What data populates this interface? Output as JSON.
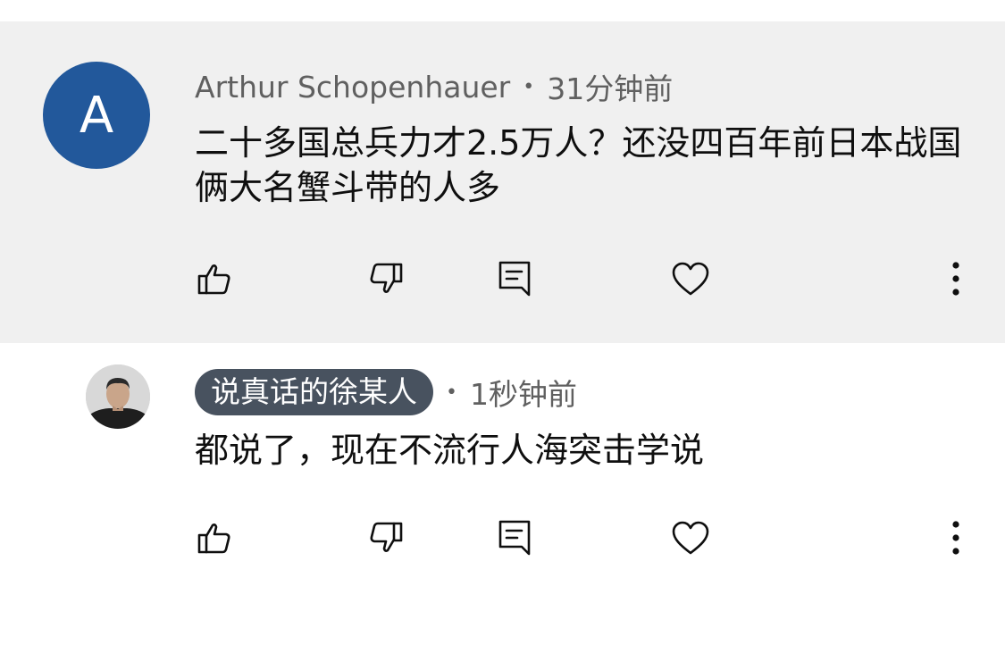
{
  "comments": [
    {
      "avatar": {
        "letter": "A",
        "color": "#22589b"
      },
      "author": "Arthur Schopenhauer",
      "separator": "•",
      "time": "31分钟前",
      "text": "二十多国总兵力才2.5万人？还没四百年前日本战国俩大名蟹斗带的人多",
      "highlighted": true,
      "background": "#f0f0f0",
      "actions": [
        "like-icon",
        "dislike-icon",
        "reply-icon",
        "heart-icon",
        "more-icon"
      ]
    },
    {
      "avatar": {
        "type": "photo"
      },
      "author": "说真话的徐某人",
      "author_chip_color": "#48525f",
      "separator": "•",
      "time": "1秒钟前",
      "text": "都说了，现在不流行人海突击学说",
      "highlighted": false,
      "actions": [
        "like-icon",
        "dislike-icon",
        "reply-icon",
        "heart-icon",
        "more-icon"
      ]
    }
  ]
}
